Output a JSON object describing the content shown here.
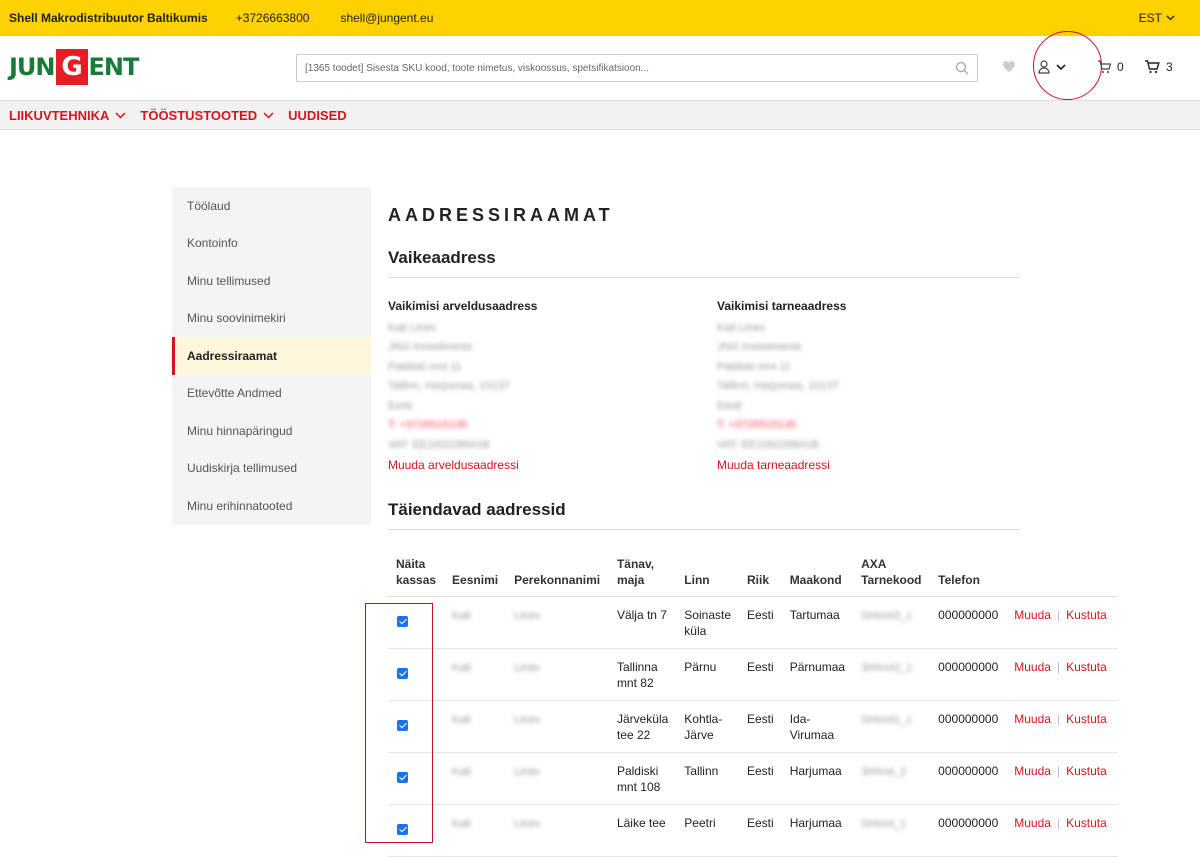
{
  "topbar": {
    "company": "Shell Makrodistribuutor Baltikumis",
    "phone": "+3726663800",
    "email": "shell@jungent.eu",
    "language": "EST"
  },
  "header": {
    "logo_left": "JUN",
    "logo_g": "G",
    "logo_right": "ENT",
    "search_placeholder": "[1365 toodet] Sisesta SKU kood, toote nimetus, viskoossus, spetsifikatsioon...",
    "compare_count": "0",
    "cart_count": "3"
  },
  "nav": {
    "items": [
      {
        "label": "LIIKUVTEHNIKA",
        "has_dropdown": true
      },
      {
        "label": "TÖÖSTUSTOOTED",
        "has_dropdown": true
      },
      {
        "label": "UUDISED",
        "has_dropdown": false
      }
    ]
  },
  "sidebar": {
    "items": [
      {
        "label": "Töölaud",
        "active": false
      },
      {
        "label": "Kontoinfo",
        "active": false
      },
      {
        "label": "Minu tellimused",
        "active": false
      },
      {
        "label": "Minu soovinimekiri",
        "active": false
      },
      {
        "label": "Aadressiraamat",
        "active": true
      },
      {
        "label": "Ettevõtte Andmed",
        "active": false
      },
      {
        "label": "Minu hinnapäringud",
        "active": false
      },
      {
        "label": "Uudiskirja tellimused",
        "active": false
      },
      {
        "label": "Minu erihinnatooted",
        "active": false
      }
    ]
  },
  "main": {
    "title": "AADRESSIRAAMAT",
    "default_section": "Vaikeaadress",
    "billing": {
      "heading": "Vaikimisi arveldusaadress",
      "lines": [
        "Kati Linev",
        "JNG Investments",
        "Paldiski mnt 11",
        "Tallinn, Harjumaa, 10137",
        "Eesti",
        "T: +3725515135",
        "VAT: EE100228841B"
      ],
      "link": "Muuda arveldusaadressi"
    },
    "shipping": {
      "heading": "Vaikimisi tarneaadress",
      "lines": [
        "Kati Linev",
        "JNG Investments",
        "Paldiski mnt 11",
        "Tallinn, Harjumaa, 10137",
        "Eesti",
        "T: +3725515135",
        "VAT: EE100228841B"
      ],
      "link": "Muuda tarneaadressi"
    },
    "additional_section": "Täiendavad aadressid"
  },
  "table": {
    "headers": [
      "Näita kassas",
      "Eesnimi",
      "Perekonnanimi",
      "Tänav, maja",
      "Linn",
      "Riik",
      "Maakond",
      "AXA Tarnekood",
      "Telefon"
    ],
    "rows": [
      {
        "checked": true,
        "first": "Kati",
        "last": "Linev",
        "street": "Välja tn 7",
        "city": "Soinaste küla",
        "country": "Eesti",
        "county": "Tartumaa",
        "axa": "SHInvt3_1",
        "phone": "000000000"
      },
      {
        "checked": true,
        "first": "Kati",
        "last": "Linev",
        "street": "Tallinna mnt 82",
        "city": "Pärnu",
        "country": "Eesti",
        "county": "Pärnumaa",
        "axa": "SHInvt2_1",
        "phone": "000000000"
      },
      {
        "checked": true,
        "first": "Kati",
        "last": "Linev",
        "street": "Järveküla tee 22",
        "city": "Kohtla-Järve",
        "country": "Eesti",
        "county": "Ida-Virumaa",
        "axa": "SHInvt1_1",
        "phone": "000000000"
      },
      {
        "checked": true,
        "first": "Kati",
        "last": "Linev",
        "street": "Paldiski mnt 108",
        "city": "Tallinn",
        "country": "Eesti",
        "county": "Harjumaa",
        "axa": "SHInvt_2",
        "phone": "000000000"
      },
      {
        "checked": true,
        "first": "Kati",
        "last": "Linev",
        "street": "Läike tee",
        "city": "Peetri",
        "country": "Eesti",
        "county": "Harjumaa",
        "axa": "SHInvt_1",
        "phone": "000000000"
      }
    ],
    "edit_label": "Muuda",
    "delete_label": "Kustuta"
  }
}
